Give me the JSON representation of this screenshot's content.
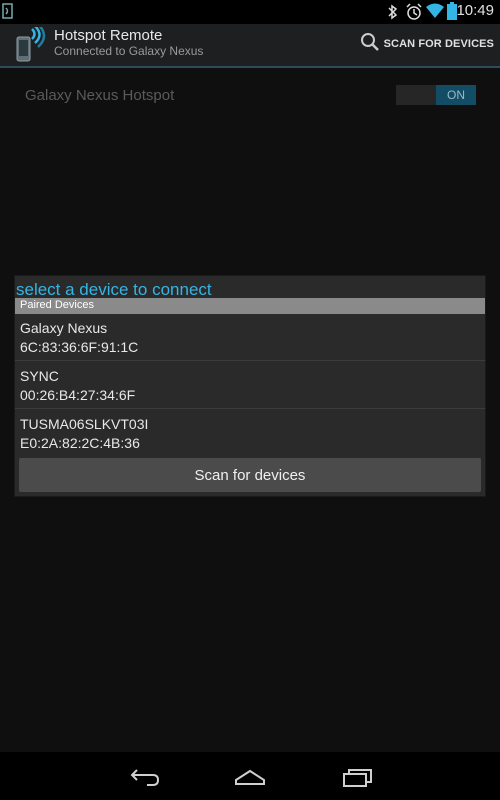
{
  "status_bar": {
    "time": "10:49",
    "icons": [
      "bluetooth-icon",
      "alarm-icon",
      "wifi-icon",
      "battery-icon"
    ]
  },
  "action_bar": {
    "title": "Hotspot Remote",
    "subtitle": "Connected to Galaxy Nexus",
    "scan_action_label": "SCAN FOR DEVICES",
    "app_icon": "phone-signal-icon"
  },
  "settings": {
    "hotspot_label": "Galaxy Nexus Hotspot",
    "toggle_state": "ON"
  },
  "dialog": {
    "title": "select a device to connect",
    "section_header": "Paired Devices",
    "devices": [
      {
        "name": "Galaxy Nexus",
        "address": "6C:83:36:6F:91:1C"
      },
      {
        "name": "SYNC",
        "address": "00:26:B4:27:34:6F"
      },
      {
        "name": "TUSMA06SLKVT03I",
        "address": "E0:2A:82:2C:4B:36"
      }
    ],
    "scan_button_label": "Scan for devices"
  },
  "nav_bar": {
    "buttons": [
      "back-icon",
      "home-icon",
      "recents-icon"
    ]
  },
  "colors": {
    "accent": "#33b5e5",
    "toggle_on": "#124d65",
    "dialog_bg": "#2a2a2a"
  }
}
